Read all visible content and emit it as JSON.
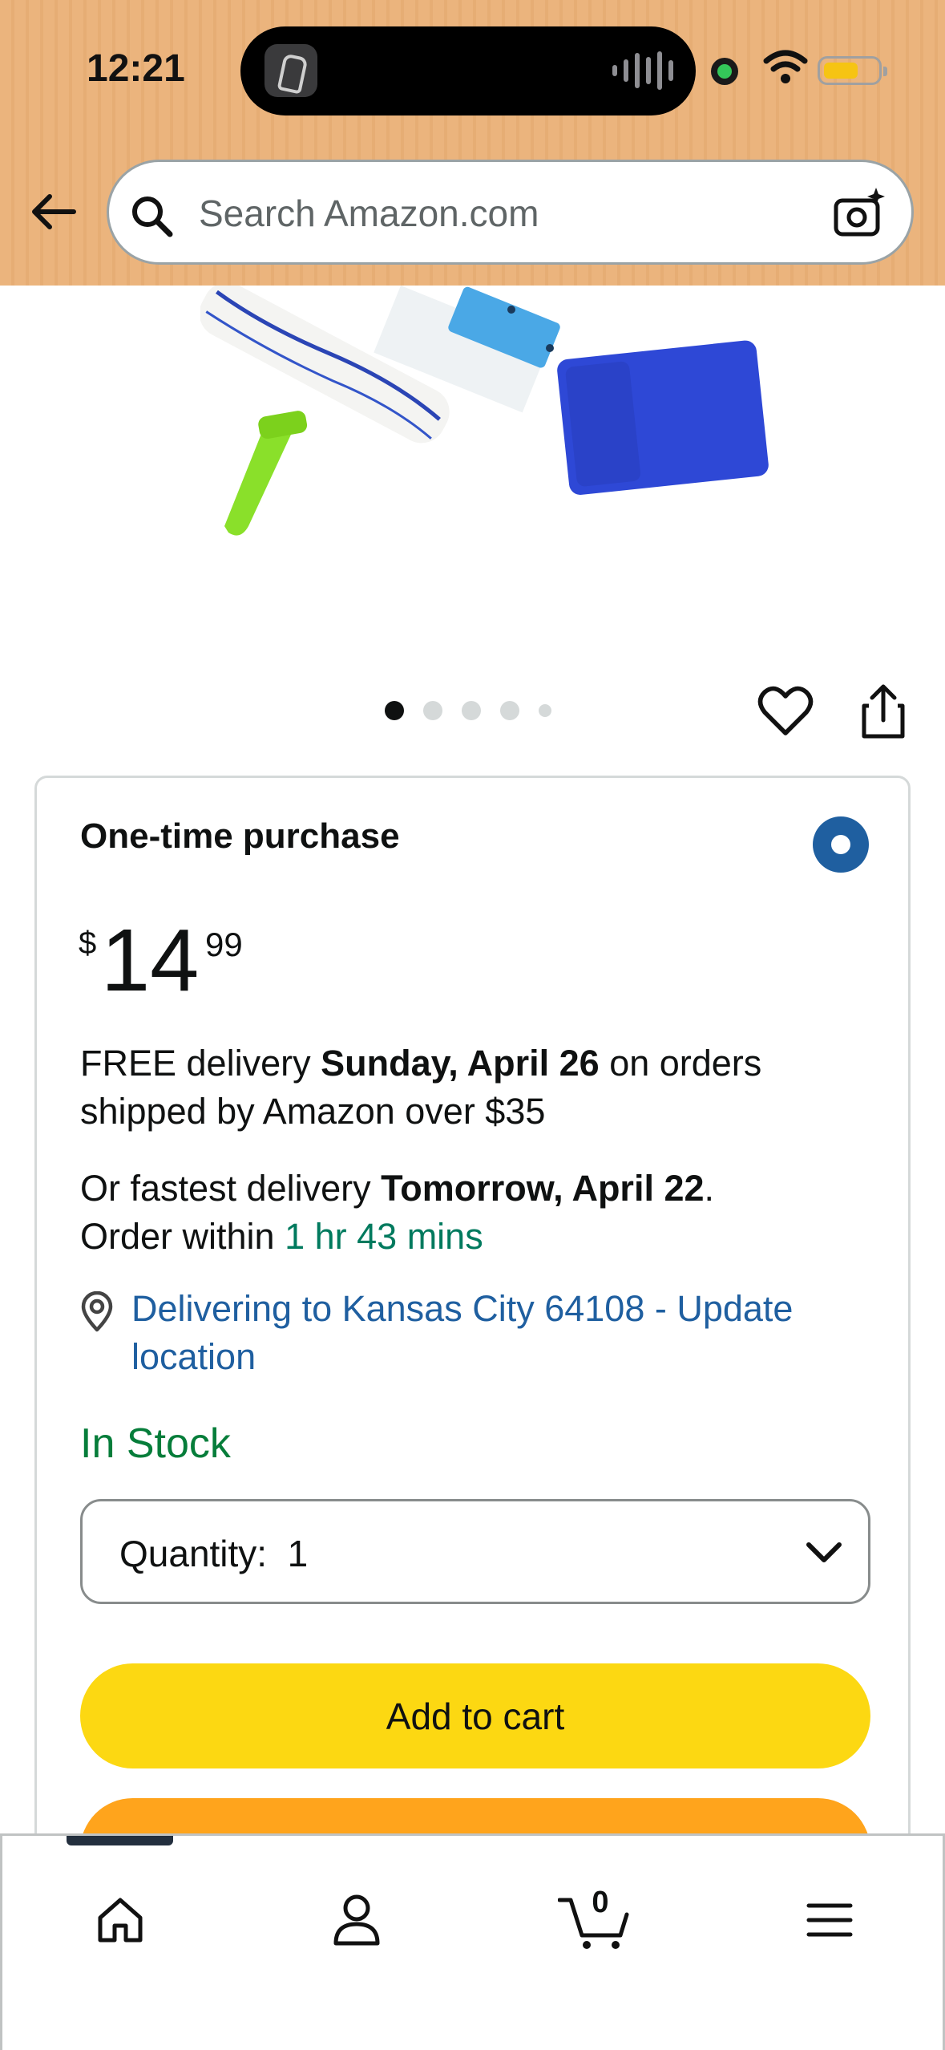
{
  "status_bar": {
    "time": "12:21"
  },
  "header": {
    "search": {
      "placeholder": "Search Amazon.com",
      "value": ""
    },
    "icons": [
      "back-arrow-icon",
      "search-icon",
      "camera-icon"
    ]
  },
  "product": {
    "image_alt": "Window squeegee set with blue microfiber cloth",
    "carousel": {
      "total": 5,
      "active_index": 0
    }
  },
  "buy_box": {
    "purchase_title": "One-time purchase",
    "price": {
      "symbol": "$",
      "whole": "14",
      "fraction": "99"
    },
    "delivery": {
      "free_prefix": "FREE delivery ",
      "free_date": "Sunday, April 26",
      "free_suffix": " on orders shipped by Amazon over $35",
      "fast_prefix": "Or fastest delivery ",
      "fast_date": "Tomorrow, April 22",
      "fast_period": ".",
      "order_within": "Order within ",
      "countdown": "1 hr 43 mins"
    },
    "location": "Delivering to Kansas City 64108 - Update location",
    "stock": "In Stock",
    "quantity": {
      "label": "Quantity:",
      "value": "1"
    },
    "add_to_cart": "Add to cart"
  },
  "tab_bar": {
    "cart_count": "0",
    "tabs": [
      "home-icon",
      "account-icon",
      "cart-icon",
      "menu-icon"
    ]
  },
  "colors": {
    "header_bg": "#ebb47d",
    "link": "#1f5fa0",
    "in_stock": "#067d3a",
    "countdown": "#007a5e",
    "add_to_cart": "#fcd812",
    "buy_now": "#ffa41c",
    "radio": "#1f5fa0"
  }
}
